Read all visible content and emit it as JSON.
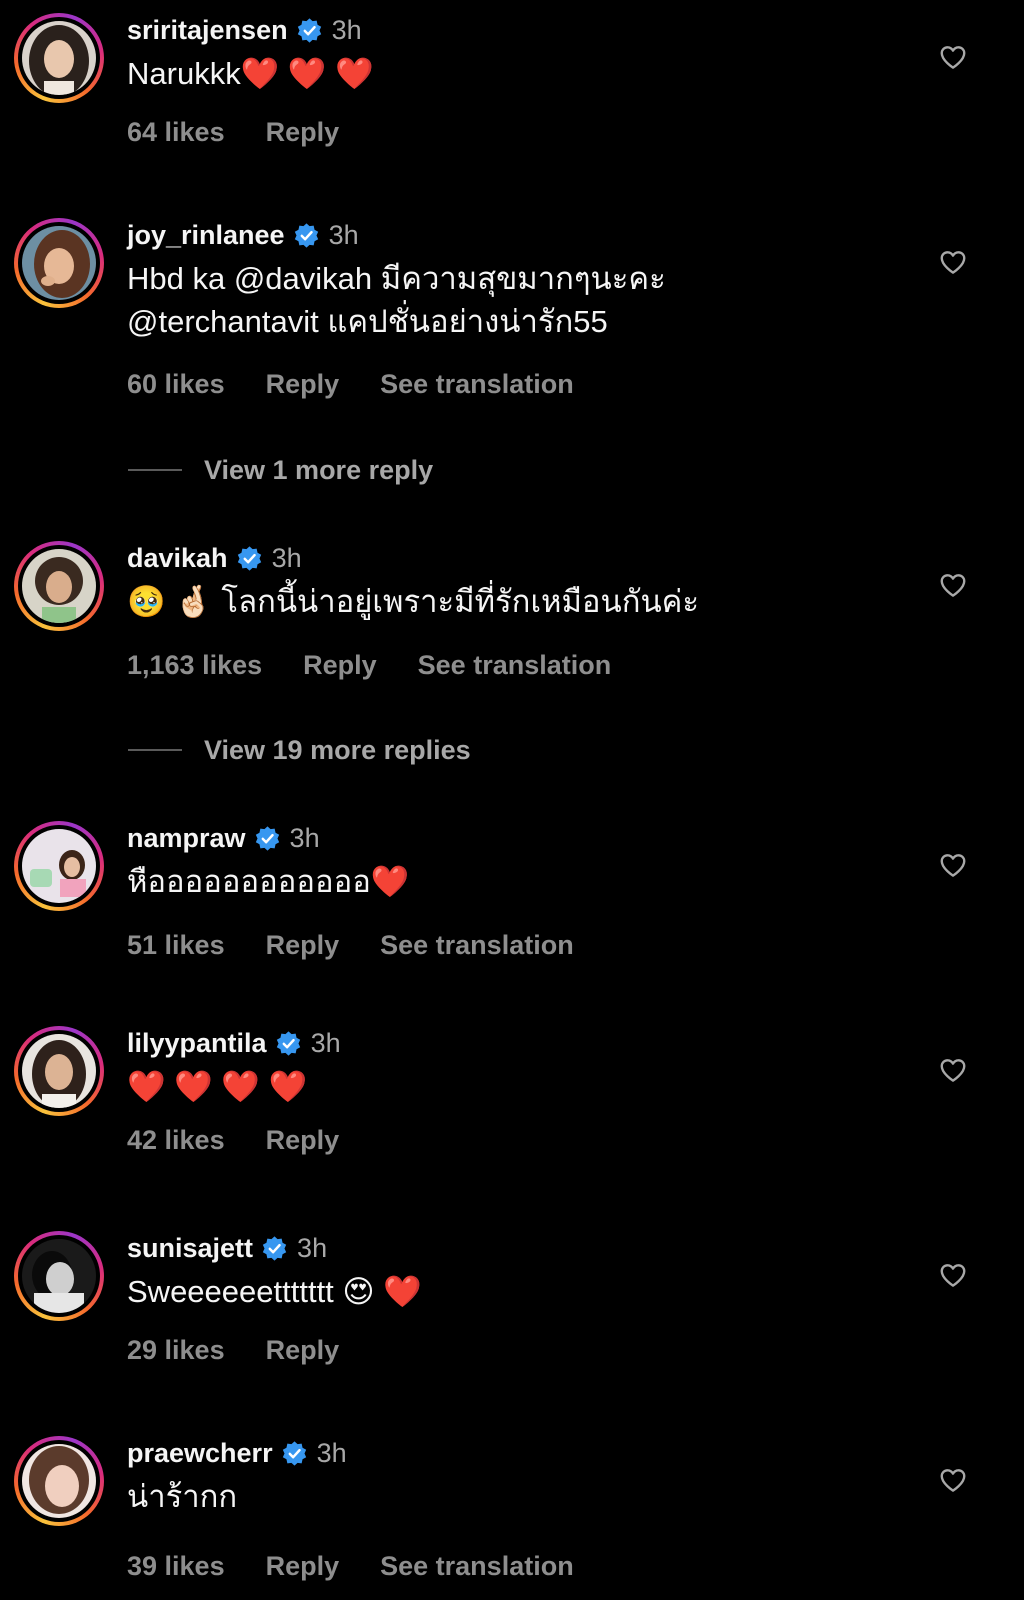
{
  "comments": [
    {
      "username": "sriritajensen",
      "time": "3h",
      "lines": [
        "Narukkk❤️ ❤️ ❤️"
      ],
      "likes": "64 likes",
      "reply": "Reply",
      "avatar": "avatar-sriritajensen"
    },
    {
      "username": "joy_rinlanee",
      "time": "3h",
      "lines": [
        "Hbd ka @davikah มีความสุขมากๆนะคะ",
        "@terchantavit แคปชั่นอย่างน่ารัก55"
      ],
      "likes": "60 likes",
      "reply": "Reply",
      "see_translation": "See translation",
      "view_replies": "View 1 more reply",
      "avatar": "avatar-joy_rinlanee"
    },
    {
      "username": "davikah",
      "time": "3h",
      "lines": [
        "🥹 🤞🏻 โลกนี้น่าอยู่เพราะมีที่รักเหมือนกันค่ะ"
      ],
      "likes": "1,163 likes",
      "reply": "Reply",
      "see_translation": "See translation",
      "view_replies": "View 19 more replies",
      "avatar": "avatar-davikah"
    },
    {
      "username": "nampraw",
      "time": "3h",
      "lines": [
        "หืออออออออออออ❤️"
      ],
      "likes": "51 likes",
      "reply": "Reply",
      "see_translation": "See translation",
      "avatar": "avatar-nampraw"
    },
    {
      "username": "lilyypantila",
      "time": "3h",
      "lines": [
        "❤️ ❤️ ❤️ ❤️"
      ],
      "likes": "42 likes",
      "reply": "Reply",
      "avatar": "avatar-lilyypantila"
    },
    {
      "username": "sunisajett",
      "time": "3h",
      "lines": [
        "Sweeeeeettttttt 😍 ❤️"
      ],
      "likes": "29 likes",
      "reply": "Reply",
      "avatar": "avatar-sunisajett"
    },
    {
      "username": "praewcherr",
      "time": "3h",
      "lines": [
        "น่าร้ากก"
      ],
      "likes": "39 likes",
      "reply": "Reply",
      "see_translation": "See translation",
      "avatar": "avatar-praewcherr"
    }
  ],
  "icons": {
    "verified": "verified-badge-icon",
    "like": "heart-outline-icon"
  },
  "colors": {
    "background": "#000000",
    "username": "#f5f5f5",
    "secondary": "#a8a8a8",
    "meta": "#8e8e8e",
    "verified": "#3797f0"
  }
}
